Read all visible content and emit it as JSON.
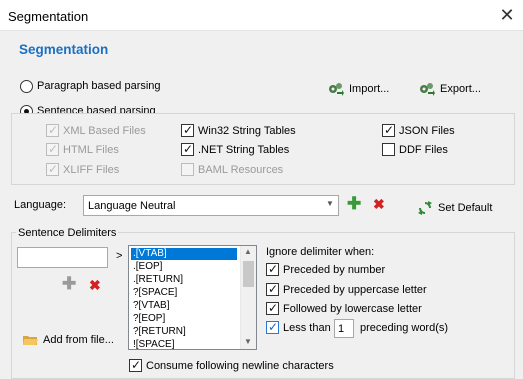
{
  "window": {
    "title": "Segmentation",
    "close_glyph": "✕"
  },
  "header": {
    "title": "Segmentation"
  },
  "parsing": {
    "paragraph_label": "Paragraph based parsing",
    "sentence_label": "Sentence based parsing",
    "selected": "sentence",
    "import_label": "Import...",
    "export_label": "Export..."
  },
  "file_types": [
    {
      "label": "XML Based Files",
      "checked": true,
      "enabled": false
    },
    {
      "label": "HTML Files",
      "checked": true,
      "enabled": false
    },
    {
      "label": "XLIFF Files",
      "checked": true,
      "enabled": false
    },
    {
      "label": "Win32 String Tables",
      "checked": true,
      "enabled": true
    },
    {
      "label": ".NET String Tables",
      "checked": true,
      "enabled": true
    },
    {
      "label": "BAML Resources",
      "checked": false,
      "enabled": false
    },
    {
      "label": "JSON Files",
      "checked": true,
      "enabled": true
    },
    {
      "label": "DDF Files",
      "checked": false,
      "enabled": true
    }
  ],
  "language": {
    "label": "Language:",
    "value": "Language Neutral",
    "set_default_label": "Set Default"
  },
  "delimiters": {
    "group_label": "Sentence Delimiters",
    "input_value": "",
    "arrow": ">",
    "items": [
      ".[VTAB]",
      ".[EOP]",
      ".[RETURN]",
      "?[SPACE]",
      "?[VTAB]",
      "?[EOP]",
      "?[RETURN]",
      "![SPACE]"
    ],
    "selected_index": 0,
    "add_from_file_label": "Add from file...",
    "ignore_title": "Ignore delimiter when:",
    "ignore_options": [
      {
        "label": "Preceded by number",
        "checked": true
      },
      {
        "label": "Preceded by uppercase letter",
        "checked": true
      },
      {
        "label": "Followed by lowercase letter",
        "checked": true
      }
    ],
    "less_than_label": "Less than",
    "less_than_checked": true,
    "less_than_value": "1",
    "preceding_words_label": "preceding word(s)",
    "consume_label": "Consume following newline characters",
    "consume_checked": true
  },
  "colors": {
    "accent": "#1e6fc0",
    "add": "#3a9a3a",
    "remove": "#d42020",
    "selection": "#0078d7"
  }
}
